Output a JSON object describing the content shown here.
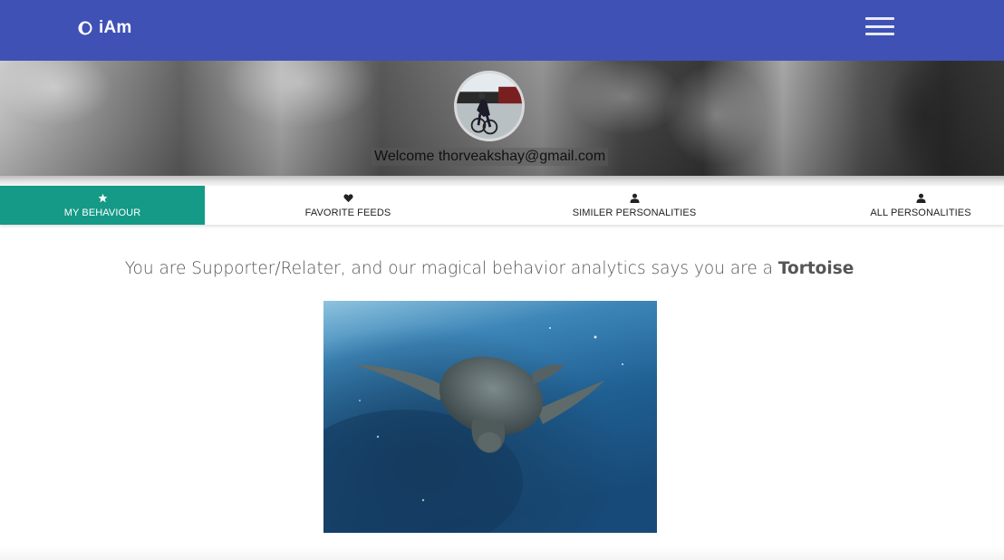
{
  "navbar": {
    "brand_text": "iAm",
    "brand_icon": "half-moon-icon",
    "menu_icon": "hamburger-menu-icon",
    "background_color": "#3f51b5"
  },
  "banner": {
    "welcome_text": "Welcome thorveakshay@gmail.com",
    "avatar_alt": "profile-avatar"
  },
  "tabs": [
    {
      "label": "MY BEHAVIOUR",
      "icon": "star-icon",
      "active": true
    },
    {
      "label": "FAVORITE FEEDS",
      "icon": "heart-icon",
      "active": false
    },
    {
      "label": "SIMILER PERSONALITIES",
      "icon": "user-icon",
      "active": false
    },
    {
      "label": "ALL PERSONALITIES",
      "icon": "user-icon",
      "active": false
    }
  ],
  "active_tab_color": "#149a87",
  "result": {
    "text": "You are Supporter/Relater, and our magical behavior analytics says you are a ",
    "animal": "Tortoise",
    "image": "sea-turtle-photo"
  }
}
